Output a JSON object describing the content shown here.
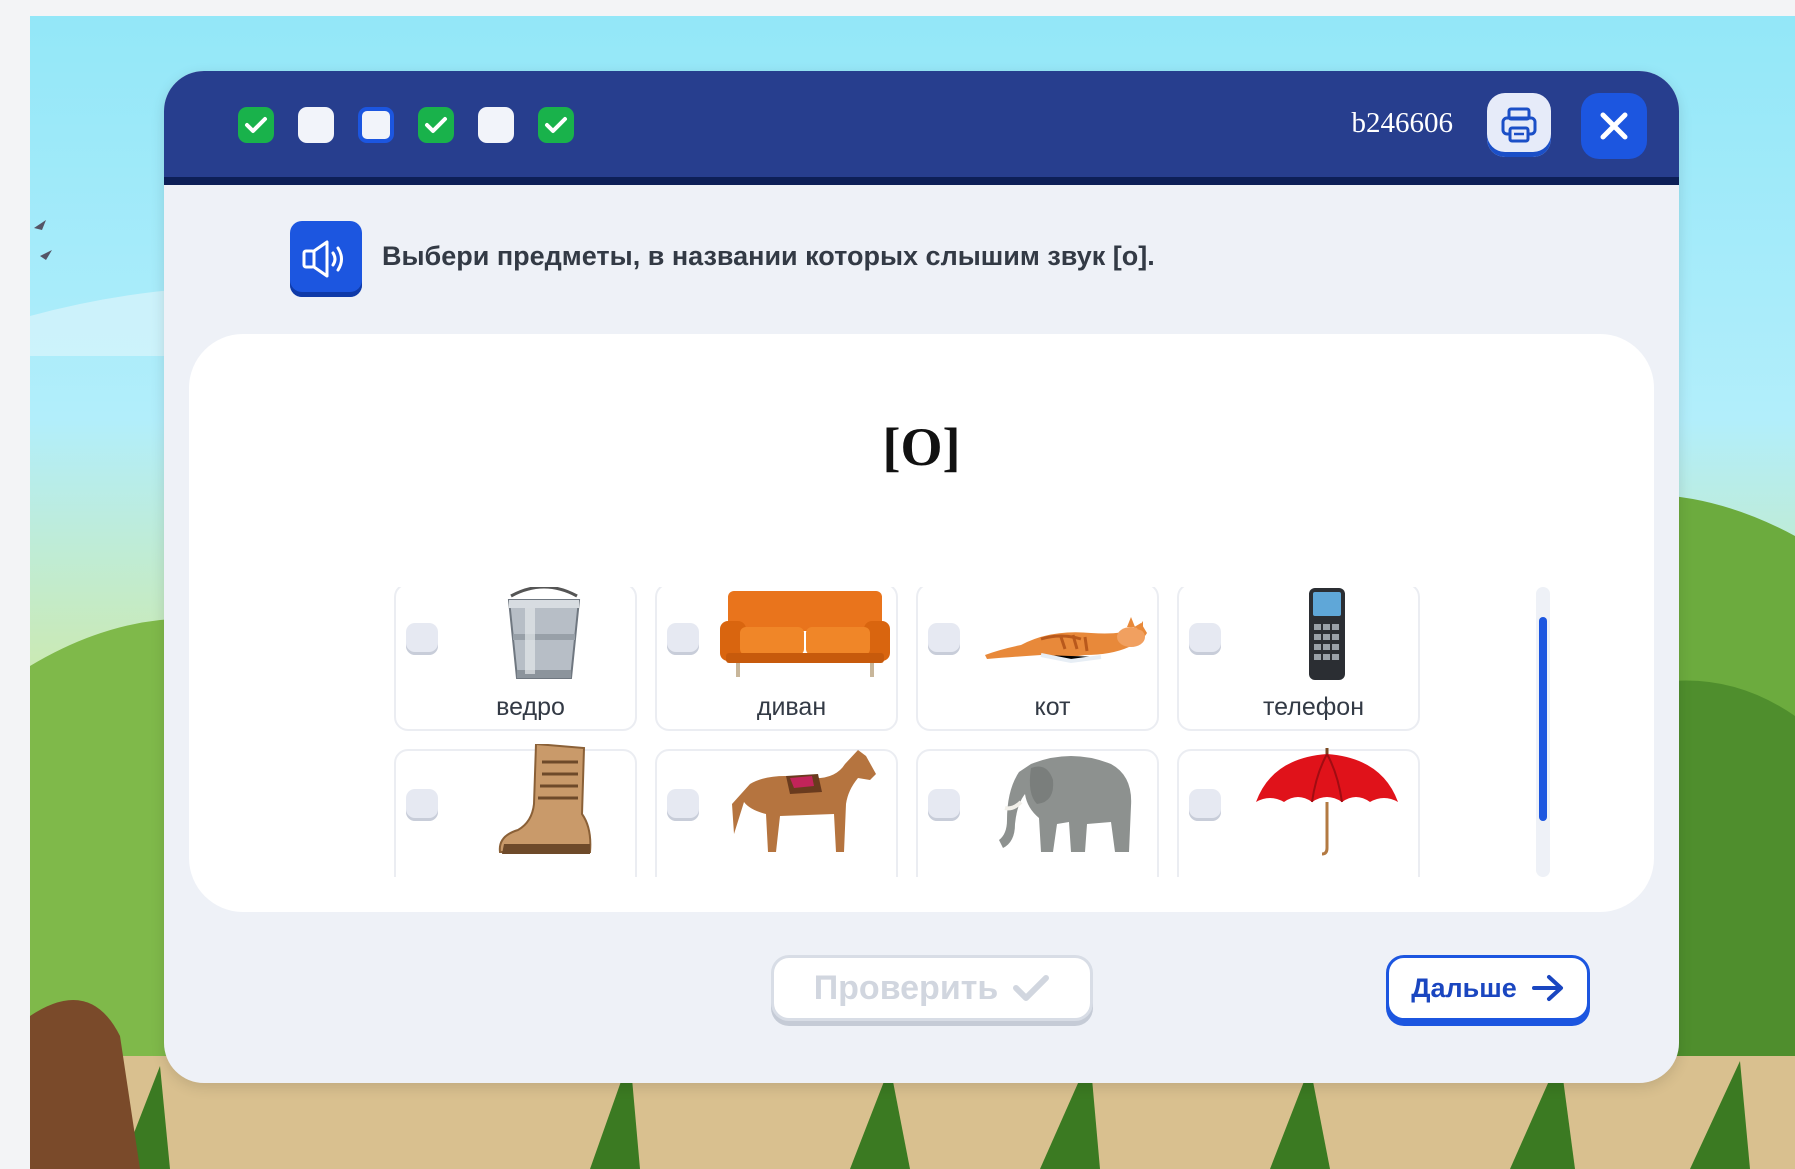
{
  "header": {
    "progress": [
      {
        "state": "done",
        "icon": "check-icon"
      },
      {
        "state": "empty",
        "icon": ""
      },
      {
        "state": "current",
        "icon": ""
      },
      {
        "state": "done",
        "icon": "check-icon"
      },
      {
        "state": "empty",
        "icon": ""
      },
      {
        "state": "done",
        "icon": "check-icon"
      }
    ],
    "task_id": "b246606",
    "print_icon": "printer-icon",
    "close_icon": "close-icon"
  },
  "task": {
    "speaker_icon": "speaker-icon",
    "instruction": "Выбери предметы, в названии которых слышим звук [о].",
    "sound": "[О]"
  },
  "items": [
    {
      "label": "ведро",
      "icon": "bucket-icon",
      "checked": false
    },
    {
      "label": "диван",
      "icon": "sofa-icon",
      "checked": false
    },
    {
      "label": "кот",
      "icon": "cat-icon",
      "checked": false
    },
    {
      "label": "телефон",
      "icon": "phone-icon",
      "checked": false
    },
    {
      "label": "",
      "icon": "boot-icon",
      "checked": false
    },
    {
      "label": "",
      "icon": "horse-icon",
      "checked": false
    },
    {
      "label": "",
      "icon": "elephant-icon",
      "checked": false
    },
    {
      "label": "",
      "icon": "umbrella-icon",
      "checked": false
    }
  ],
  "buttons": {
    "check_label": "Проверить",
    "next_label": "Дальше"
  },
  "colors": {
    "header": "#273e8e",
    "accent": "#1c56e0",
    "done": "#19b24b"
  }
}
